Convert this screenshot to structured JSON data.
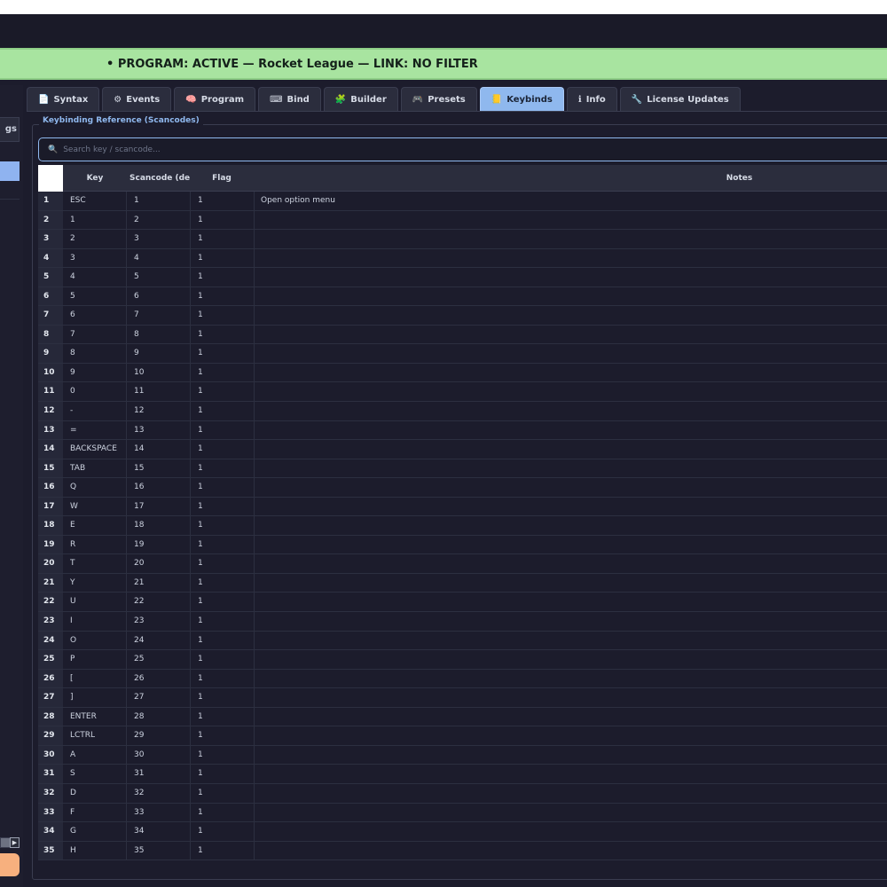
{
  "status": {
    "text": "• PROGRAM: ACTIVE — Rocket League — LINK: NO FILTER",
    "color": "#a8e4a0"
  },
  "sidebar": {
    "header_label": "gs"
  },
  "tabs": [
    {
      "icon": "📄",
      "icon_name": "document-icon",
      "label": "Syntax",
      "active": false
    },
    {
      "icon": "⚙",
      "icon_name": "events-icon",
      "label": "Events",
      "active": false
    },
    {
      "icon": "🧠",
      "icon_name": "brain-icon",
      "label": "Program",
      "active": false
    },
    {
      "icon": "⌨",
      "icon_name": "keyboard-icon",
      "label": "Bind",
      "active": false
    },
    {
      "icon": "🧩",
      "icon_name": "puzzle-icon",
      "label": "Builder",
      "active": false
    },
    {
      "icon": "🎮",
      "icon_name": "gamepad-icon",
      "label": "Presets",
      "active": false
    },
    {
      "icon": "📒",
      "icon_name": "ledger-icon",
      "label": "Keybinds",
      "active": true
    },
    {
      "icon": "ℹ",
      "icon_name": "info-icon",
      "label": "Info",
      "active": false
    },
    {
      "icon": "🔧",
      "icon_name": "wrench-icon",
      "label": "License  Updates",
      "active": false
    }
  ],
  "group": {
    "title": "Keybinding Reference (Scancodes)"
  },
  "search": {
    "placeholder": "Search key / scancode..."
  },
  "table": {
    "headers": {
      "key": "Key",
      "scancode": "Scancode (dec",
      "flag": "Flag",
      "notes": "Notes"
    },
    "rows": [
      {
        "n": "1",
        "key": "ESC",
        "scancode": "1",
        "flag": "1",
        "notes": "Open option menu"
      },
      {
        "n": "2",
        "key": "1",
        "scancode": "2",
        "flag": "1",
        "notes": ""
      },
      {
        "n": "3",
        "key": "2",
        "scancode": "3",
        "flag": "1",
        "notes": ""
      },
      {
        "n": "4",
        "key": "3",
        "scancode": "4",
        "flag": "1",
        "notes": ""
      },
      {
        "n": "5",
        "key": "4",
        "scancode": "5",
        "flag": "1",
        "notes": ""
      },
      {
        "n": "6",
        "key": "5",
        "scancode": "6",
        "flag": "1",
        "notes": ""
      },
      {
        "n": "7",
        "key": "6",
        "scancode": "7",
        "flag": "1",
        "notes": ""
      },
      {
        "n": "8",
        "key": "7",
        "scancode": "8",
        "flag": "1",
        "notes": ""
      },
      {
        "n": "9",
        "key": "8",
        "scancode": "9",
        "flag": "1",
        "notes": ""
      },
      {
        "n": "10",
        "key": "9",
        "scancode": "10",
        "flag": "1",
        "notes": ""
      },
      {
        "n": "11",
        "key": "0",
        "scancode": "11",
        "flag": "1",
        "notes": ""
      },
      {
        "n": "12",
        "key": "-",
        "scancode": "12",
        "flag": "1",
        "notes": ""
      },
      {
        "n": "13",
        "key": "=",
        "scancode": "13",
        "flag": "1",
        "notes": ""
      },
      {
        "n": "14",
        "key": "BACKSPACE",
        "scancode": "14",
        "flag": "1",
        "notes": ""
      },
      {
        "n": "15",
        "key": "TAB",
        "scancode": "15",
        "flag": "1",
        "notes": ""
      },
      {
        "n": "16",
        "key": "Q",
        "scancode": "16",
        "flag": "1",
        "notes": ""
      },
      {
        "n": "17",
        "key": "W",
        "scancode": "17",
        "flag": "1",
        "notes": ""
      },
      {
        "n": "18",
        "key": "E",
        "scancode": "18",
        "flag": "1",
        "notes": ""
      },
      {
        "n": "19",
        "key": "R",
        "scancode": "19",
        "flag": "1",
        "notes": ""
      },
      {
        "n": "20",
        "key": "T",
        "scancode": "20",
        "flag": "1",
        "notes": ""
      },
      {
        "n": "21",
        "key": "Y",
        "scancode": "21",
        "flag": "1",
        "notes": ""
      },
      {
        "n": "22",
        "key": "U",
        "scancode": "22",
        "flag": "1",
        "notes": ""
      },
      {
        "n": "23",
        "key": "I",
        "scancode": "23",
        "flag": "1",
        "notes": ""
      },
      {
        "n": "24",
        "key": "O",
        "scancode": "24",
        "flag": "1",
        "notes": ""
      },
      {
        "n": "25",
        "key": "P",
        "scancode": "25",
        "flag": "1",
        "notes": ""
      },
      {
        "n": "26",
        "key": "[",
        "scancode": "26",
        "flag": "1",
        "notes": ""
      },
      {
        "n": "27",
        "key": "]",
        "scancode": "27",
        "flag": "1",
        "notes": ""
      },
      {
        "n": "28",
        "key": "ENTER",
        "scancode": "28",
        "flag": "1",
        "notes": ""
      },
      {
        "n": "29",
        "key": "LCTRL",
        "scancode": "29",
        "flag": "1",
        "notes": ""
      },
      {
        "n": "30",
        "key": "A",
        "scancode": "30",
        "flag": "1",
        "notes": ""
      },
      {
        "n": "31",
        "key": "S",
        "scancode": "31",
        "flag": "1",
        "notes": ""
      },
      {
        "n": "32",
        "key": "D",
        "scancode": "32",
        "flag": "1",
        "notes": ""
      },
      {
        "n": "33",
        "key": "F",
        "scancode": "33",
        "flag": "1",
        "notes": ""
      },
      {
        "n": "34",
        "key": "G",
        "scancode": "34",
        "flag": "1",
        "notes": ""
      },
      {
        "n": "35",
        "key": "H",
        "scancode": "35",
        "flag": "1",
        "notes": ""
      }
    ]
  }
}
